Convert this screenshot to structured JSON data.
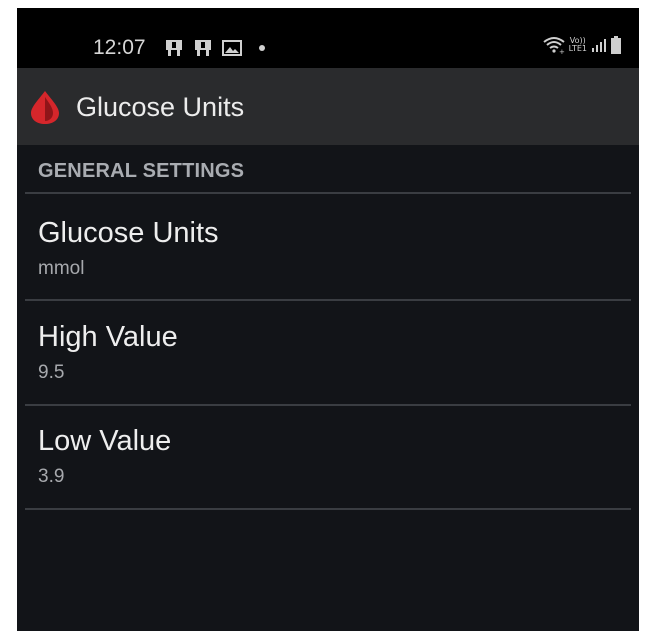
{
  "status_bar": {
    "time": "12:07",
    "left_icons": [
      "notification-app-icon",
      "notification-app-icon",
      "image-icon",
      "dot-icon"
    ],
    "right_icons": [
      "wifi-icon",
      "volte-lte-icon",
      "signal-icon",
      "battery-icon"
    ],
    "volte_top": "Vo))",
    "volte_bottom": "LTE1"
  },
  "toolbar": {
    "title": "Glucose Units",
    "logo_icon": "blood-drop-icon",
    "logo_color": "#d5262b"
  },
  "settings": {
    "section_header": "GENERAL SETTINGS",
    "items": [
      {
        "title": "Glucose Units",
        "summary": "mmol"
      },
      {
        "title": "High Value",
        "summary": "9.5"
      },
      {
        "title": "Low Value",
        "summary": "3.9"
      }
    ]
  }
}
